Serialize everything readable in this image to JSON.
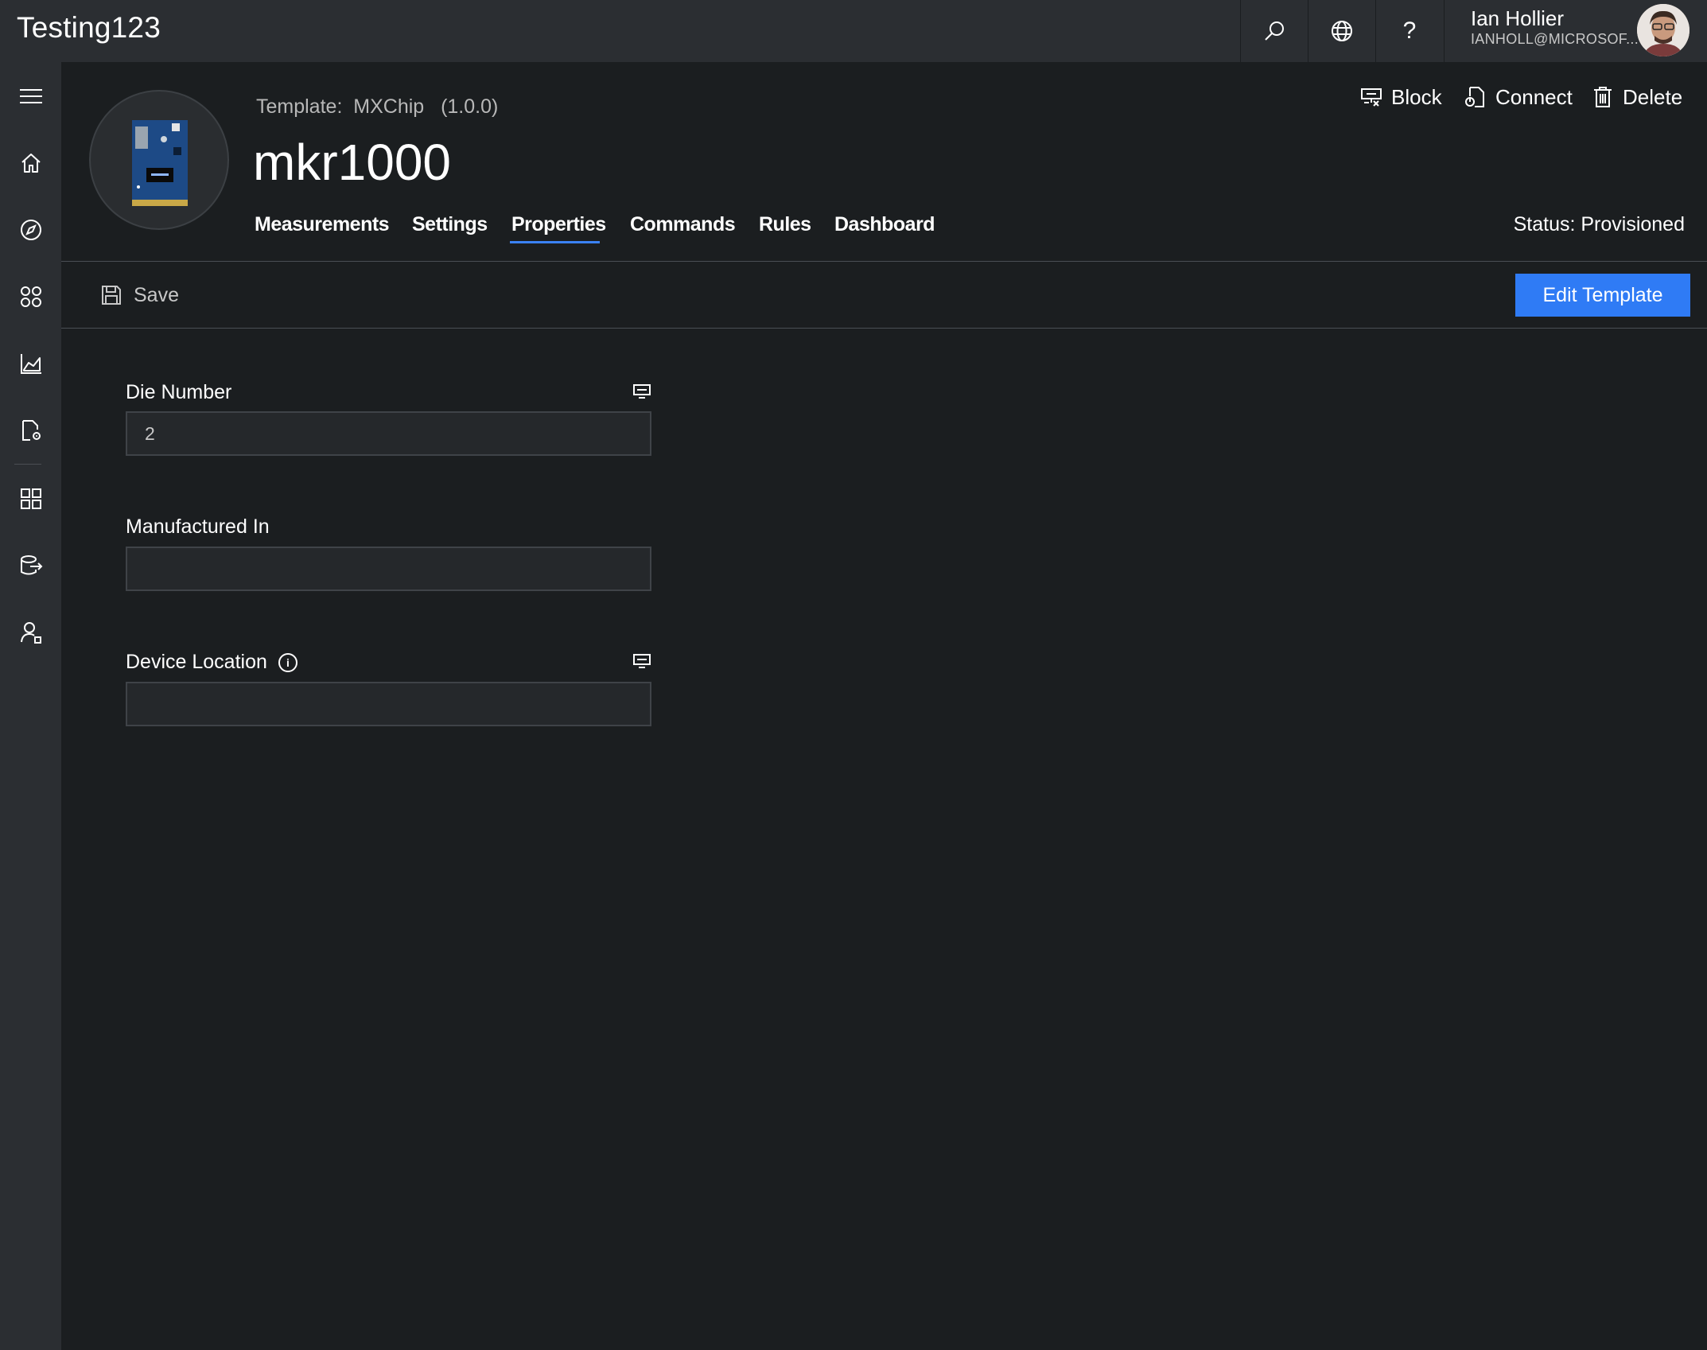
{
  "app": {
    "title": "Testing123"
  },
  "topbar": {
    "search_icon": "search-icon",
    "globe_icon": "globe-icon",
    "help_icon": "help-icon",
    "help_label": "?",
    "user": {
      "name": "Ian Hollier",
      "email": "IANHOLL@MICROSOF..."
    }
  },
  "leftrail": {
    "items": [
      "menu-icon",
      "home-icon",
      "explorer-icon",
      "device-sets-icon",
      "analytics-icon",
      "jobs-icon",
      "device-templates-icon",
      "export-icon",
      "administration-icon"
    ]
  },
  "device": {
    "template_prefix": "Template:",
    "template_name": "MXChip",
    "template_version": "(1.0.0)",
    "name": "mkr1000",
    "status": "Status: Provisioned"
  },
  "actions": {
    "block": "Block",
    "connect": "Connect",
    "delete": "Delete"
  },
  "tabs": [
    {
      "label": "Measurements",
      "active": false
    },
    {
      "label": "Settings",
      "active": false
    },
    {
      "label": "Properties",
      "active": true
    },
    {
      "label": "Commands",
      "active": false
    },
    {
      "label": "Rules",
      "active": false
    },
    {
      "label": "Dashboard",
      "active": false
    }
  ],
  "toolbar": {
    "save_label": "Save",
    "edit_template_label": "Edit Template"
  },
  "form": {
    "fields": [
      {
        "label": "Die Number",
        "value": "2",
        "has_device_icon": true,
        "has_info": false
      },
      {
        "label": "Manufactured In",
        "value": "",
        "has_device_icon": false,
        "has_info": false
      },
      {
        "label": "Device Location",
        "value": "",
        "has_device_icon": true,
        "has_info": true
      }
    ]
  },
  "colors": {
    "accent": "#2f7bf5",
    "background": "#1b1e20",
    "chrome": "#2b2e32"
  }
}
